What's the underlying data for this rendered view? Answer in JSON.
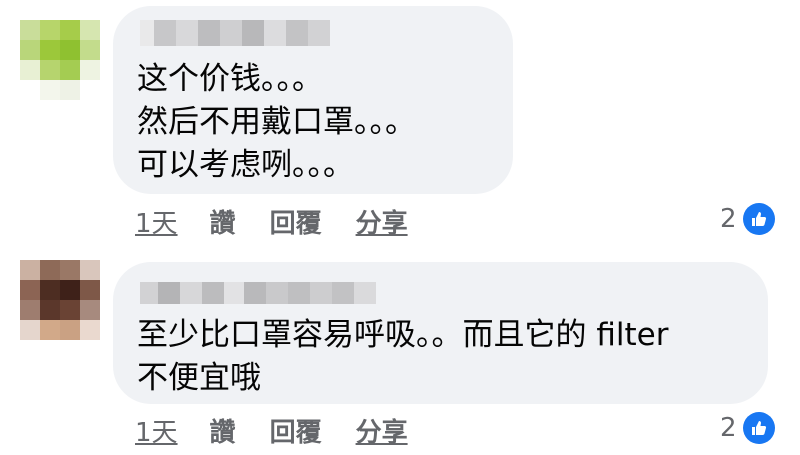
{
  "comments": [
    {
      "text_lines": [
        "这个价钱。。。",
        "然后不用戴口罩。。。",
        "可以考虑咧。。。"
      ],
      "actions": {
        "time": "1天",
        "like": "讚",
        "reply": "回覆",
        "share": "分享"
      },
      "reactions": {
        "count": "2",
        "icon": "like-icon"
      }
    },
    {
      "text_lines": [
        "至少比口罩容易呼吸。。而且它的 filter",
        "不便宜哦"
      ],
      "actions": {
        "time": "1天",
        "like": "讚",
        "reply": "回覆",
        "share": "分享"
      },
      "reactions": {
        "count": "2",
        "icon": "like-icon"
      }
    }
  ],
  "colors": {
    "bubble": "#f0f2f5",
    "text": "#050505",
    "secondary": "#65676b",
    "like_blue": "#1877f2"
  }
}
